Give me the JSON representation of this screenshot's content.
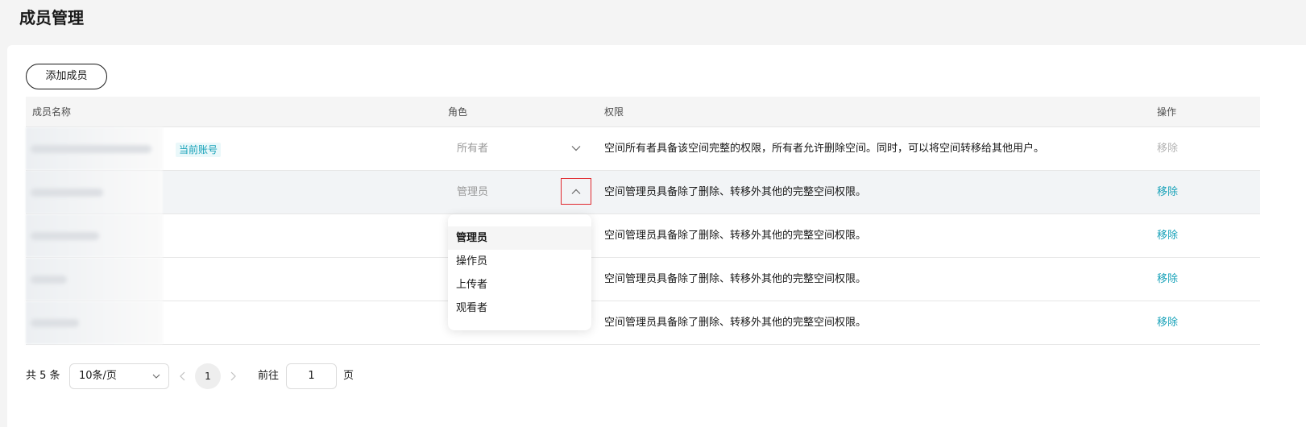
{
  "page": {
    "title": "成员管理"
  },
  "toolbar": {
    "add_label": "添加成员"
  },
  "table": {
    "headers": {
      "name": "成员名称",
      "role": "角色",
      "permission": "权限",
      "action": "操作"
    },
    "rows": [
      {
        "tag": "当前账号",
        "role": "所有者",
        "permission": "空间所有者具备该空间完整的权限，所有者允许删除空间。同时，可以将空间转移给其他用户。",
        "action": "移除"
      },
      {
        "role": "管理员",
        "permission": "空间管理员具备除了删除、转移外其他的完整空间权限。",
        "action": "移除"
      },
      {
        "permission": "空间管理员具备除了删除、转移外其他的完整空间权限。",
        "action": "移除"
      },
      {
        "permission": "空间管理员具备除了删除、转移外其他的完整空间权限。",
        "action": "移除"
      },
      {
        "permission": "空间管理员具备除了删除、转移外其他的完整空间权限。",
        "action": "移除"
      }
    ]
  },
  "role_dropdown": {
    "options": [
      "管理员",
      "操作员",
      "上传者",
      "观看者"
    ],
    "selected": "管理员"
  },
  "pagination": {
    "total": "共 5 条",
    "page_size": "10条/页",
    "current_page": "1",
    "goto_label": "前往",
    "goto_value": "1",
    "page_suffix": "页"
  },
  "colors": {
    "accent": "#16a1b8",
    "focus_border": "#e0282e",
    "disabled": "#b2b2b2"
  }
}
